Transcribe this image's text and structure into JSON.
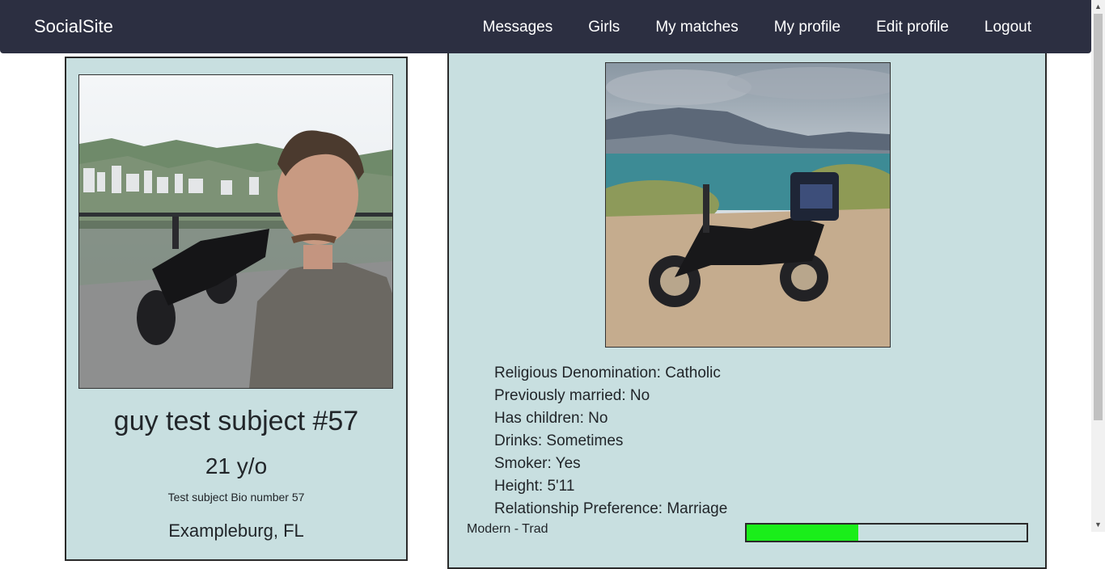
{
  "navbar": {
    "brand": "SocialSite",
    "links": [
      "Messages",
      "Girls",
      "My matches",
      "My profile",
      "Edit profile",
      "Logout"
    ]
  },
  "profile": {
    "name": "guy test subject #57",
    "age": "21 y/o",
    "bio": "Test subject Bio number 57",
    "location": "Exampleburg, FL"
  },
  "details": [
    "Religious Denomination: Catholic",
    "Previously married: No",
    "Has children: No",
    "Drinks: Sometimes",
    "Smoker: Yes",
    "Height: 5'11",
    "Relationship Preference: Marriage"
  ],
  "scale": {
    "label": "Modern - Trad",
    "value_fraction": 0.4,
    "fill_color": "#1aee1a"
  },
  "colors": {
    "navbar": "#2c2f41",
    "card_background": "#c8dfe0"
  }
}
